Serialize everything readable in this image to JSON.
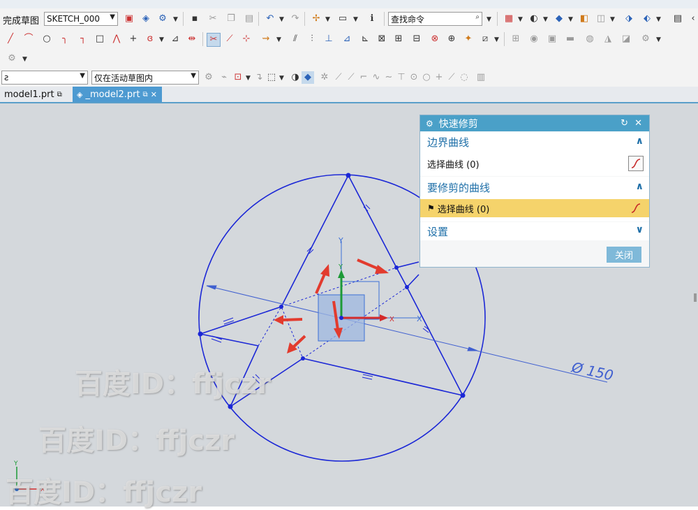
{
  "toolbar": {
    "finish_sketch": "完成草图",
    "sketch_name": "SKETCH_000",
    "find_command_placeholder": "查找命令",
    "scope_selector": "仅在活动草图内",
    "filter_selector": "ƨ"
  },
  "tabs": [
    {
      "label": "model1.prt"
    },
    {
      "label": "_model2.prt"
    }
  ],
  "dialog": {
    "title": "快速修剪",
    "boundary_section": "边界曲线",
    "boundary_select": "选择曲线 (0)",
    "trim_section": "要修剪的曲线",
    "trim_select": "选择曲线 (0)",
    "settings_section": "设置",
    "close_label": "关闭"
  },
  "sketch": {
    "dimension": "Ø 150",
    "axis_x": "X",
    "axis_y": "Y"
  },
  "watermarks": [
    "百度ID：ffjczr",
    "百度ID：ffjczr",
    "百度ID：ffjczr"
  ],
  "colors": {
    "sketch_curve": "#1b27d6",
    "dialog_header": "#4aa0c8",
    "highlight_row": "#f5d36b",
    "arrow": "#e23b2e"
  }
}
